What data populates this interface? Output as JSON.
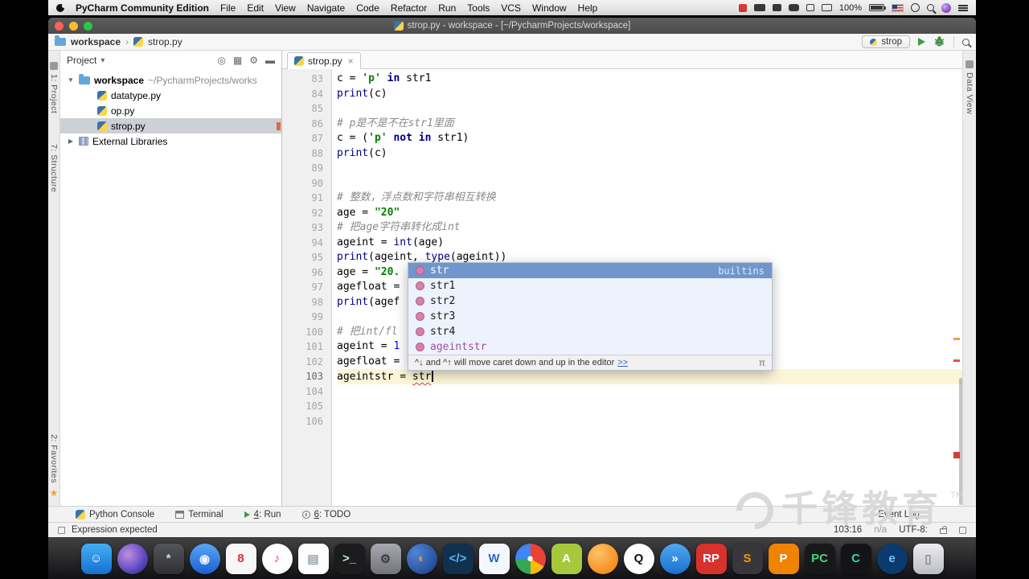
{
  "menu_bar": {
    "app_name": "PyCharm Community Edition",
    "items": [
      "File",
      "Edit",
      "View",
      "Navigate",
      "Code",
      "Refactor",
      "Run",
      "Tools",
      "VCS",
      "Window",
      "Help"
    ],
    "battery": "100%"
  },
  "window": {
    "title": "strop.py - workspace - [~/PycharmProjects/workspace]"
  },
  "navbar": {
    "path": [
      {
        "label": "workspace"
      },
      {
        "label": "strop.py"
      }
    ],
    "separator": "›",
    "run_config": "strop"
  },
  "left_stripe": {
    "project": "1: Project",
    "structure": "7: Structure",
    "favorites": "2: Favorites"
  },
  "right_stripe": {
    "label": "Data View"
  },
  "project_panel": {
    "header": "Project",
    "root_name": "workspace",
    "root_path": " ~/PycharmProjects/works",
    "files": [
      "datatype.py",
      "op.py",
      "strop.py"
    ],
    "selected": "strop.py",
    "external": "External Libraries"
  },
  "editor": {
    "tab": "strop.py",
    "lines": [
      {
        "no": 83,
        "segs": [
          [
            "p",
            "c = "
          ],
          [
            "s",
            "'p'"
          ],
          [
            "p",
            " "
          ],
          [
            "k",
            "in"
          ],
          [
            "p",
            " str1"
          ]
        ]
      },
      {
        "no": 84,
        "segs": [
          [
            "b",
            "print"
          ],
          [
            "p",
            "(c)"
          ]
        ]
      },
      {
        "no": 85,
        "segs": []
      },
      {
        "no": 86,
        "segs": [
          [
            "c",
            "# p是不是不在str1里面"
          ]
        ]
      },
      {
        "no": 87,
        "segs": [
          [
            "p",
            "c = ("
          ],
          [
            "s",
            "'p'"
          ],
          [
            "p",
            " "
          ],
          [
            "k",
            "not"
          ],
          [
            "p",
            " "
          ],
          [
            "k",
            "in"
          ],
          [
            "p",
            " str1)"
          ]
        ]
      },
      {
        "no": 88,
        "segs": [
          [
            "b",
            "print"
          ],
          [
            "p",
            "(c)"
          ]
        ]
      },
      {
        "no": 89,
        "segs": []
      },
      {
        "no": 90,
        "segs": []
      },
      {
        "no": 91,
        "segs": [
          [
            "c",
            "# 整数，浮点数和字符串相互转换"
          ]
        ]
      },
      {
        "no": 92,
        "segs": [
          [
            "p",
            "age = "
          ],
          [
            "s",
            "\"20\""
          ]
        ]
      },
      {
        "no": 93,
        "segs": [
          [
            "c",
            "# 把age字符串转化成int"
          ]
        ]
      },
      {
        "no": 94,
        "segs": [
          [
            "p",
            "ageint = "
          ],
          [
            "b",
            "int"
          ],
          [
            "p",
            "(age)"
          ]
        ]
      },
      {
        "no": 95,
        "segs": [
          [
            "b",
            "print"
          ],
          [
            "p",
            "(ageint, "
          ],
          [
            "b",
            "type"
          ],
          [
            "p",
            "(ageint))"
          ]
        ]
      },
      {
        "no": 96,
        "segs": [
          [
            "p",
            "age = "
          ],
          [
            "s",
            "\"20."
          ]
        ]
      },
      {
        "no": 97,
        "segs": [
          [
            "p",
            "agefloat = "
          ]
        ]
      },
      {
        "no": 98,
        "segs": [
          [
            "b",
            "print"
          ],
          [
            "p",
            "(agef"
          ]
        ]
      },
      {
        "no": 99,
        "segs": []
      },
      {
        "no": 100,
        "segs": [
          [
            "c",
            "# 把int/fl"
          ]
        ]
      },
      {
        "no": 101,
        "segs": [
          [
            "p",
            "ageint = "
          ],
          [
            "n",
            "1"
          ]
        ]
      },
      {
        "no": 102,
        "segs": [
          [
            "p",
            "agefloat ="
          ]
        ]
      },
      {
        "no": 103,
        "segs": [
          [
            "p",
            "ageintstr = "
          ],
          [
            "e",
            "str"
          ]
        ],
        "current": true,
        "caret": true
      },
      {
        "no": 104,
        "segs": []
      },
      {
        "no": 105,
        "segs": []
      },
      {
        "no": 106,
        "segs": []
      }
    ]
  },
  "completion": {
    "selected": {
      "label": "str",
      "tail": "builtins"
    },
    "items": [
      {
        "label": "str1"
      },
      {
        "label": "str2"
      },
      {
        "label": "str3"
      },
      {
        "label": "str4"
      },
      {
        "label": "ageintstr",
        "accent": true
      }
    ],
    "hint": "^↓ and ^↑ will move caret down and up in the editor ",
    "hint_link": ">>",
    "sort_icon": "π"
  },
  "bottom_bar": {
    "items": [
      {
        "icon": "python",
        "text": "Python Console"
      },
      {
        "icon": "terminal",
        "text": "Terminal"
      },
      {
        "icon": "run",
        "mnemonic": "4",
        "text": ": Run"
      },
      {
        "icon": "todo",
        "mnemonic": "6",
        "text": ": TODO"
      }
    ],
    "event_log": "Event Log"
  },
  "status_bar": {
    "message": "Expression expected",
    "caret_position": "103:16",
    "line_separator": "n/a",
    "encoding": "UTF-8:"
  },
  "watermark": {
    "text": "千锋教育",
    "tm": "TM"
  },
  "dock": {
    "items": [
      {
        "name": "finder",
        "glyph": "☺",
        "bg": "linear-gradient(180deg,#45aef5,#1570cf)",
        "color": "#ffffff"
      },
      {
        "name": "siri",
        "glyph": "",
        "bg": "radial-gradient(circle at 35% 35%,#c08fe0,#5a48c0 60%,#262655)",
        "round": true
      },
      {
        "name": "launchpad",
        "glyph": "*",
        "bg": "linear-gradient(180deg,#55555c,#2e2e33)",
        "color": "#cfd6e4"
      },
      {
        "name": "safari",
        "glyph": "◉",
        "bg": "linear-gradient(180deg,#57a7f7,#1b5fd0)",
        "color": "#eef4ff",
        "round": true
      },
      {
        "name": "browser-8",
        "glyph": "8",
        "bg": "#f7f7f7",
        "color": "#e0302e"
      },
      {
        "name": "itunes",
        "glyph": "♪",
        "bg": "#ffffff",
        "color": "#f5327b",
        "round": true
      },
      {
        "name": "notes",
        "glyph": "▤",
        "bg": "#fdfdfd",
        "color": "#9aa3ad"
      },
      {
        "name": "terminal",
        "glyph": ">_",
        "bg": "#1c1c1f",
        "color": "#bfe8c5"
      },
      {
        "name": "system-preferences",
        "glyph": "⚙",
        "bg": "linear-gradient(180deg,#a8a8b0,#73737b)",
        "color": "#3c3c42"
      },
      {
        "name": "firefox",
        "glyph": "◐",
        "bg": "radial-gradient(circle at 30% 30%,#4f86d8,#173a80)",
        "color": "#ff9824",
        "round": true
      },
      {
        "name": "code-editor",
        "glyph": "</>",
        "bg": "#10304e",
        "color": "#53b9f5"
      },
      {
        "name": "word",
        "glyph": "W",
        "bg": "#f4f8fd",
        "color": "#2b67c0"
      },
      {
        "name": "chrome",
        "glyph": "●",
        "bg": "conic-gradient(#ea4335 0deg 120deg,#fbbc05 120deg 180deg,#34a853 180deg 270deg,#4285f4 270deg 360deg)",
        "color": "#ffffff",
        "round": true
      },
      {
        "name": "android",
        "glyph": "A",
        "bg": "#a6c93c",
        "color": "#ffffff"
      },
      {
        "name": "orange-ball",
        "glyph": "",
        "bg": "radial-gradient(circle at 35% 30%,#ffc069,#ef7d00)",
        "round": true
      },
      {
        "name": "qq",
        "glyph": "Q",
        "bg": "#ffffff",
        "color": "#111111",
        "round": true
      },
      {
        "name": "thunder",
        "glyph": "»",
        "bg": "linear-gradient(180deg,#4fa8ee,#1a6fd0)",
        "color": "#ffffff",
        "round": true
      },
      {
        "name": "rp-app",
        "glyph": "RP",
        "bg": "#d8322e",
        "color": "#ffffff"
      },
      {
        "name": "sublime",
        "glyph": "S",
        "bg": "#36363b",
        "color": "#ff9800"
      },
      {
        "name": "p-app",
        "glyph": "P",
        "bg": "#f08300",
        "color": "#ffffff"
      },
      {
        "name": "pycharm",
        "glyph": "PC",
        "bg": "#18181a",
        "color": "#4dd17e"
      },
      {
        "name": "clion",
        "glyph": "C",
        "bg": "#141416",
        "color": "#35d0b4"
      },
      {
        "name": "browser-e",
        "glyph": "e",
        "bg": "#0d3a6e",
        "color": "#6cc4ff",
        "round": true
      },
      {
        "name": "trash",
        "glyph": "▯",
        "bg": "linear-gradient(180deg,#ededf2,#bcbcc6)",
        "color": "#8b8b95"
      }
    ]
  }
}
